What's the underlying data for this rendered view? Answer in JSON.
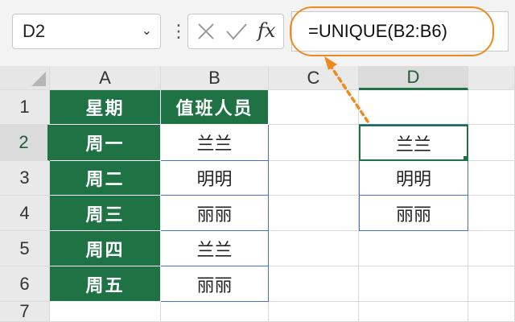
{
  "formula_bar": {
    "name_box": "D2",
    "name_caret": "⌄",
    "menu_dots": "⋮",
    "fx_label": "fx",
    "formula": "=UNIQUE(B2:B6)"
  },
  "columns": [
    "A",
    "B",
    "C",
    "D"
  ],
  "rows": [
    "1",
    "2",
    "3",
    "4",
    "5",
    "6",
    "7"
  ],
  "table": {
    "headers": [
      "星期",
      "值班人员"
    ],
    "rows": [
      [
        "周一",
        "兰兰"
      ],
      [
        "周二",
        "明明"
      ],
      [
        "周三",
        "丽丽"
      ],
      [
        "周四",
        "兰兰"
      ],
      [
        "周五",
        "丽丽"
      ]
    ]
  },
  "unique_result": [
    "兰兰",
    "明明",
    "丽丽"
  ],
  "selected_cell": "D2",
  "colors": {
    "header_green": "#1f7244",
    "selection_green": "#1e7145",
    "range_blue": "#4472c4",
    "highlight_orange": "#ef8a1e"
  },
  "icons": {
    "cancel": "x-icon",
    "enter": "checkmark-icon",
    "function": "fx-icon"
  }
}
